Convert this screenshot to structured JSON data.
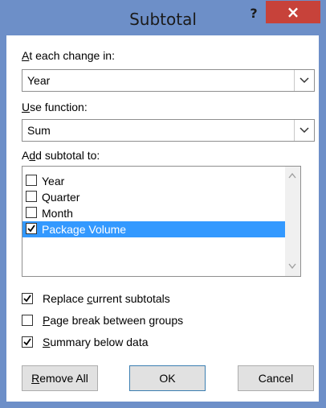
{
  "window": {
    "title": "Subtotal",
    "help_glyph": "?",
    "close_glyph": "×"
  },
  "at_each_change": {
    "label_u": "A",
    "label_rest": "t each change in:",
    "value": "Year"
  },
  "use_function": {
    "label_u": "U",
    "label_rest": "se function:",
    "value": "Sum"
  },
  "add_subtotal": {
    "label_pre": "A",
    "label_u": "d",
    "label_rest": "d subtotal to:",
    "items": [
      {
        "label": "Year",
        "checked": false,
        "selected": false
      },
      {
        "label": "Quarter",
        "checked": false,
        "selected": false
      },
      {
        "label": "Month",
        "checked": false,
        "selected": false
      },
      {
        "label": "Package Volume",
        "checked": true,
        "selected": true
      }
    ]
  },
  "options": {
    "replace": {
      "pre": "Replace ",
      "u": "c",
      "rest": "urrent subtotals",
      "checked": true
    },
    "page_break": {
      "pre": "",
      "u": "P",
      "rest": "age break between groups",
      "checked": false
    },
    "summary": {
      "pre": "",
      "u": "S",
      "rest": "ummary below data",
      "checked": true
    }
  },
  "buttons": {
    "remove_all": {
      "u": "R",
      "rest": "emove All"
    },
    "ok": "OK",
    "cancel": "Cancel"
  }
}
